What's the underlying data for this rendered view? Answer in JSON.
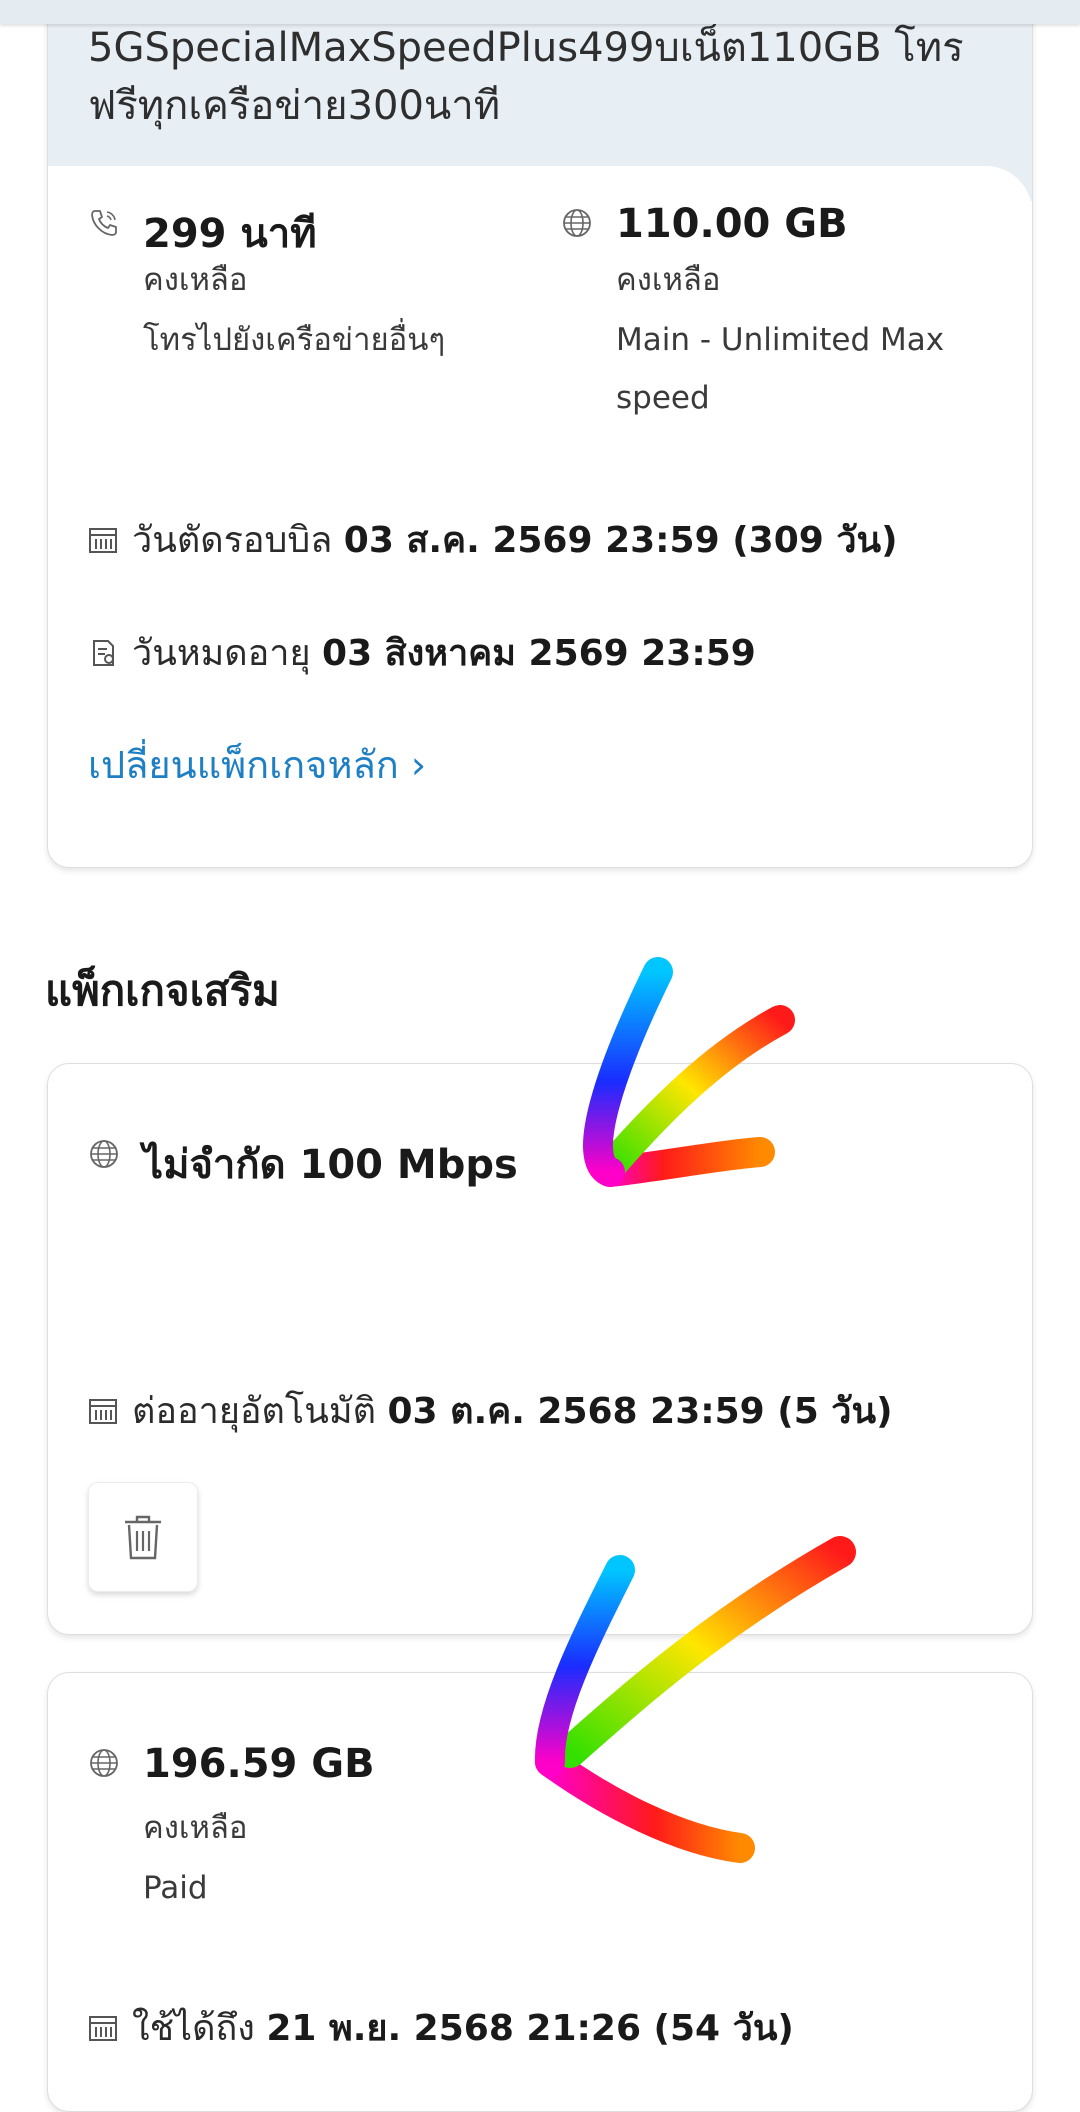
{
  "main_package": {
    "plan_name": "5GSpecialMaxSpeedPlus499บเน็ต110GB โทรฟรีทุกเครือข่าย300นาที",
    "voice": {
      "icon": "phone-icon",
      "value": "299 นาที",
      "status": "คงเหลือ",
      "detail": "โทรไปยังเครือข่ายอื่นๆ"
    },
    "data": {
      "icon": "globe-icon",
      "value": "110.00 GB",
      "status": "คงเหลือ",
      "detail_line1": "Main - Unlimited Max",
      "detail_line2": "speed"
    },
    "bill_cycle": {
      "icon": "calendar-icon",
      "label": "วันตัดรอบบิล",
      "value": "03 ส.ค. 2569 23:59 (309 วัน)"
    },
    "expiry": {
      "icon": "document-icon",
      "label": "วันหมดอายุ",
      "value": "03 สิงหาคม 2569 23:59"
    },
    "change_link": "เปลี่ยนแพ็กเกจหลัก ›"
  },
  "addons": {
    "section_title": "แพ็กเกจเสริม",
    "item1": {
      "icon": "globe-icon",
      "title": "ไม่จำกัด 100 Mbps",
      "renew": {
        "icon": "calendar-icon",
        "label": "ต่ออายุอัตโนมัติ",
        "value": "03 ต.ค. 2568 23:59 (5 วัน)"
      },
      "delete_icon": "trash-icon"
    },
    "item2": {
      "icon": "globe-icon",
      "value": "196.59 GB",
      "status": "คงเหลือ",
      "detail": "Paid",
      "valid": {
        "icon": "calendar-icon",
        "label": "ใช้ได้ถึง",
        "value": "21 พ.ย. 2568 21:26 (54 วัน)"
      }
    }
  },
  "annotations": {
    "arrow_colors": [
      "#ff00c8",
      "#ff1a1a",
      "#ff8a00",
      "#ffe600",
      "#33e000",
      "#00c6ff",
      "#1a2cff"
    ]
  }
}
